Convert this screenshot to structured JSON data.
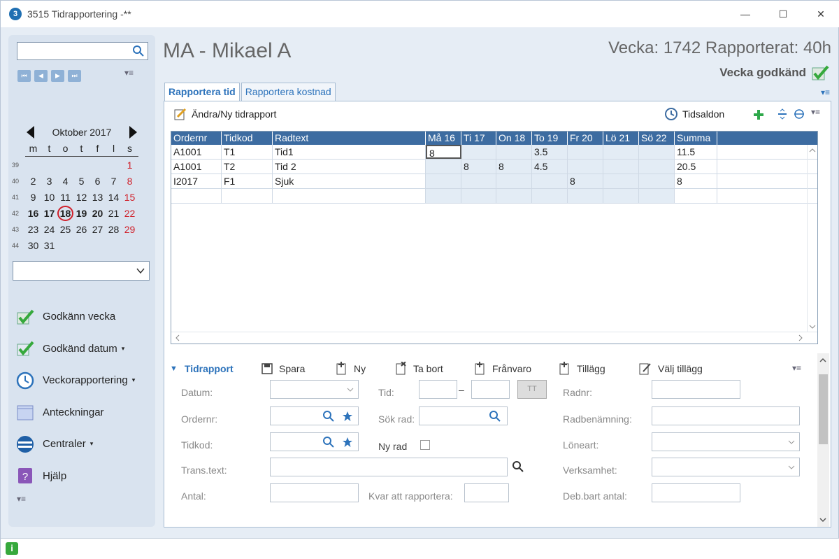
{
  "window": {
    "app_icon_text": "3",
    "title": "3515 Tidrapportering -**",
    "minimize": "—",
    "maximize": "☐",
    "close": "✕"
  },
  "sidebar": {
    "search_placeholder": "",
    "calendar": {
      "month": "Oktober 2017",
      "weekdays": [
        "m",
        "t",
        "o",
        "t",
        "f",
        "l",
        "s"
      ],
      "weeks": [
        {
          "no": "39",
          "days": [
            "",
            "",
            "",
            "",
            "",
            "",
            "1"
          ]
        },
        {
          "no": "40",
          "days": [
            "2",
            "3",
            "4",
            "5",
            "6",
            "7",
            "8"
          ]
        },
        {
          "no": "41",
          "days": [
            "9",
            "10",
            "11",
            "12",
            "13",
            "14",
            "15"
          ]
        },
        {
          "no": "42",
          "days": [
            "16",
            "17",
            "18",
            "19",
            "20",
            "21",
            "22"
          ]
        },
        {
          "no": "43",
          "days": [
            "23",
            "24",
            "25",
            "26",
            "27",
            "28",
            "29"
          ]
        },
        {
          "no": "44",
          "days": [
            "30",
            "31",
            "",
            "",
            "",
            "",
            ""
          ]
        }
      ]
    },
    "nav": [
      {
        "label": "Godkänn vecka",
        "dropdown": ""
      },
      {
        "label": "Godkänd datum",
        "dropdown": "▾"
      },
      {
        "label": "Veckorapportering",
        "dropdown": "▾"
      },
      {
        "label": "Anteckningar",
        "dropdown": ""
      },
      {
        "label": "Centraler",
        "dropdown": "▾"
      },
      {
        "label": "Hjälp",
        "dropdown": ""
      }
    ]
  },
  "header": {
    "employee": "MA - Mikael A",
    "week": "Vecka: 1742 Rapporterat: 40h",
    "approved": "Vecka godkänd"
  },
  "tabs": [
    "Rapportera tid",
    "Rapportera kostnad"
  ],
  "toolbar": {
    "edit": "Ändra/Ny tidrapport",
    "balance": "Tidsaldon"
  },
  "grid": {
    "columns": [
      "Ordernr",
      "Tidkod",
      "Radtext",
      "Må  16",
      "Ti  17",
      "On  18",
      "To  19",
      "Fr  20",
      "Lö  21",
      "Sö  22",
      "Summa"
    ],
    "rows": [
      [
        "A1001",
        "T1",
        "Tid1",
        "8",
        "",
        "",
        "3.5",
        "",
        "",
        "",
        "11.5"
      ],
      [
        "A1001",
        "T2",
        "Tid 2",
        "",
        "8",
        "8",
        "4.5",
        "",
        "",
        "",
        "20.5"
      ],
      [
        "I2017",
        "F1",
        "Sjuk",
        "",
        "",
        "",
        "",
        "8",
        "",
        "",
        "8"
      ],
      [
        "",
        "",
        "",
        "",
        "",
        "",
        "",
        "",
        "",
        "",
        ""
      ]
    ]
  },
  "details": {
    "toolbar": [
      "Tidrapport",
      "Spara",
      "Ny",
      "Ta bort",
      "Frånvaro",
      "Tillägg",
      "Välj tillägg"
    ],
    "labels": {
      "datum": "Datum:",
      "ordernr": "Ordernr:",
      "tidkod": "Tidkod:",
      "trans": "Trans.text:",
      "antal": "Antal:",
      "tid": "Tid:",
      "sokrad": "Sök rad:",
      "nyrad": "Ny rad",
      "kvar": "Kvar att rapportera:",
      "radnr": "Radnr:",
      "radben": "Radbenämning:",
      "loneart": "Löneart:",
      "verksamhet": "Verksamhet:",
      "debbart": "Deb.bart antal:"
    },
    "tt_button": "TT",
    "time_separator": "–"
  },
  "icons": [
    "search-icon",
    "first-icon",
    "prev-icon",
    "next-icon",
    "last-icon",
    "checkmark-icon",
    "clock-icon",
    "notebook-icon",
    "central-icon",
    "help-icon",
    "save-icon",
    "add-icon"
  ],
  "colors": {
    "accent": "#2d73bb",
    "header": "#3d6ca1",
    "green": "#36a93c",
    "red": "#d0202a"
  }
}
